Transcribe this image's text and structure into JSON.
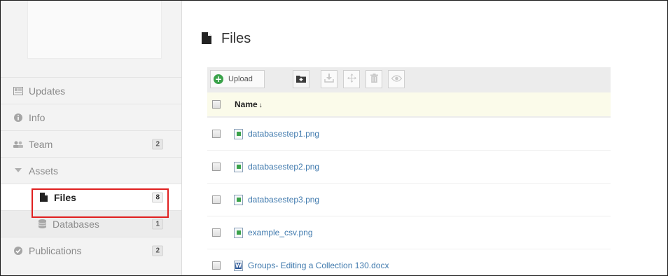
{
  "sidebar": {
    "items": [
      {
        "label": "Updates",
        "icon": "updates-icon",
        "count": null
      },
      {
        "label": "Info",
        "icon": "info-icon",
        "count": null
      },
      {
        "label": "Team",
        "icon": "team-icon",
        "count": "2"
      },
      {
        "label": "Assets",
        "icon": "triangle-down-icon",
        "count": null
      },
      {
        "label": "Files",
        "icon": "file-icon",
        "count": "8",
        "active": true
      },
      {
        "label": "Databases",
        "icon": "database-icon",
        "count": "1"
      },
      {
        "label": "Publications",
        "icon": "publications-icon",
        "count": "2"
      }
    ]
  },
  "main": {
    "title": "Files",
    "title_icon": "file-icon",
    "toolbar": {
      "upload_label": "Upload",
      "buttons": [
        "new-folder-icon",
        "download-icon",
        "move-icon",
        "trash-icon",
        "eye-icon"
      ]
    },
    "table": {
      "name_header": "Name",
      "sort_indicator": "↓",
      "files": [
        {
          "name": "databasestep1.png",
          "type": "image"
        },
        {
          "name": "databasestep2.png",
          "type": "image"
        },
        {
          "name": "databasestep3.png",
          "type": "image"
        },
        {
          "name": "example_csv.png",
          "type": "image"
        },
        {
          "name": "Groups- Editing a Collection 130.docx",
          "type": "word-document"
        }
      ]
    }
  },
  "colors": {
    "link": "#3f79ad",
    "upload_green": "#3aa24a",
    "highlight_outline": "#e02020",
    "table_header_bg": "#fbfbea"
  }
}
